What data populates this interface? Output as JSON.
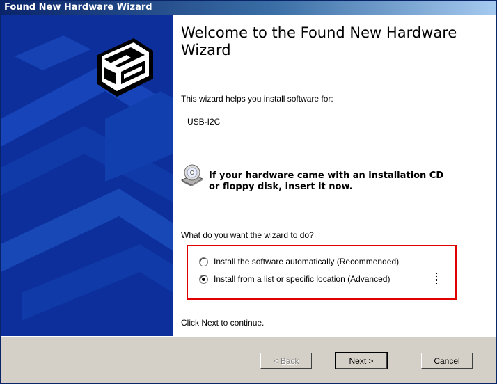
{
  "window": {
    "title": "Found New Hardware Wizard"
  },
  "content": {
    "heading": "Welcome to the Found New Hardware Wizard",
    "intro": "This wizard helps you install software for:",
    "device_name": "USB-I2C",
    "cd_message_line1": "If your hardware came with an installation CD",
    "cd_message_line2": "or floppy disk, insert it now.",
    "question": "What do you want the wizard to do?",
    "options": [
      {
        "label": "Install the software automatically (Recommended)",
        "access_key": "I",
        "selected": false
      },
      {
        "label": "Install from a list or specific location (Advanced)",
        "access_key": "I",
        "selected": true
      }
    ],
    "continue_text": "Click Next to continue."
  },
  "buttons": {
    "back": "< Back",
    "next": "Next >",
    "cancel": "Cancel"
  },
  "icons": {
    "wizard": "hardware-box-icon",
    "cd": "cd-floppy-icon"
  },
  "colors": {
    "sidebar": "#0c2f9c",
    "highlight_border": "#e00000",
    "dialog_face": "#d4d0c8"
  }
}
